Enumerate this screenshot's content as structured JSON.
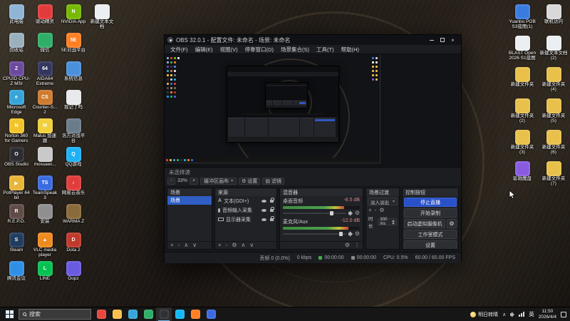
{
  "desktop": {
    "left_columns": [
      {
        "items": [
          {
            "label": "此电脑",
            "color": "#8fb4d4"
          },
          {
            "label": "回收站",
            "color": "#9bb0bd"
          },
          {
            "label": "CPUID CPU-Z MSI",
            "color": "#6b4a9e",
            "glyph": "Z"
          },
          {
            "label": "Microsoft Edge",
            "color": "#35a5d9",
            "glyph": "e"
          },
          {
            "label": "Norton 360 for Gamers",
            "color": "#f2c42a",
            "glyph": "N"
          },
          {
            "label": "OBS Studio",
            "color": "#2b2b30",
            "glyph": "O"
          },
          {
            "label": "PotPlayer 64 bit",
            "color": "#e8b53a",
            "glyph": "▶"
          },
          {
            "label": "R.E.P.O.",
            "color": "#5f4a46",
            "glyph": "R"
          },
          {
            "label": "Steam",
            "color": "#223c5e",
            "glyph": "S"
          },
          {
            "label": "腾讯会议",
            "color": "#2f8fe5"
          }
        ]
      },
      {
        "items": [
          {
            "label": "驱动精灵",
            "color": "#e23b3b"
          },
          {
            "label": "微信",
            "color": "#2fae68"
          },
          {
            "label": "AIDA64 Extreme",
            "color": "#33355e",
            "glyph": "64"
          },
          {
            "label": "Counter-S... 2",
            "color": "#cf7a2e",
            "glyph": "CS"
          },
          {
            "label": "Malus 加速器",
            "color": "#f2d03a",
            "glyph": "M"
          },
          {
            "label": "mossawi...",
            "color": "#c9c9c9"
          },
          {
            "label": "TeamSpeak 3",
            "color": "#3a6be0",
            "glyph": "TS"
          },
          {
            "label": "安装",
            "color": "#8f8f8f"
          },
          {
            "label": "VLC media player",
            "color": "#ef8a1e",
            "glyph": "▲"
          },
          {
            "label": "LINE",
            "color": "#06c152",
            "glyph": "L"
          }
        ]
      },
      {
        "items": [
          {
            "label": "NVIDIA App",
            "color": "#76b900",
            "glyph": "N"
          },
          {
            "label": "5E对战平台",
            "color": "#ff7e22",
            "glyph": "5E"
          },
          {
            "label": "系统信息",
            "color": "#4a90d9"
          },
          {
            "label": "我记了吗",
            "color": "#e9e9ec"
          },
          {
            "label": "浩方对战平台",
            "color": "#6a7b8a"
          },
          {
            "label": "QQ游戏",
            "color": "#1cb2f5",
            "glyph": "Q"
          },
          {
            "label": "网易云音乐",
            "color": "#e03c3c",
            "glyph": "♪"
          },
          {
            "label": "WARMA Z",
            "color": "#8a6a3a"
          },
          {
            "label": "Dota 2",
            "color": "#c0392b",
            "glyph": "D"
          },
          {
            "label": "Oopz",
            "color": "#6a5ae0"
          }
        ]
      },
      {
        "items": [
          {
            "label": "新建文本文档",
            "color": "#eceff1"
          }
        ]
      }
    ],
    "right_columns": [
      {
        "items": [
          {
            "label": "Yuanbo POB S3蓝图(1)",
            "color": "#3a7be0"
          },
          {
            "label": "BLAST Open 2026 S1蓝图",
            "color": "#eceff1"
          },
          {
            "label": "新建文件夹",
            "color": "#e8c04a"
          },
          {
            "label": "新建文件夹 (2)",
            "color": "#e8c04a"
          },
          {
            "label": "新建文件夹 (3)",
            "color": "#e8c04a"
          },
          {
            "label": "影驰魔盘",
            "color": "#8a5ae0"
          }
        ]
      },
      {
        "items": [
          {
            "label": "联机访问",
            "color": "#d8d8d8"
          },
          {
            "label": "新建文本文档 (2)",
            "color": "#eceff1"
          },
          {
            "label": "新建文件夹 (4)",
            "color": "#e8c04a"
          },
          {
            "label": "新建文件夹 (5)",
            "color": "#e8c04a"
          },
          {
            "label": "新建文件夹 (6)",
            "color": "#e8c04a"
          },
          {
            "label": "新建文件夹 (7)",
            "color": "#e8c04a"
          }
        ]
      }
    ]
  },
  "obs": {
    "title": "OBS 32.0.1 - 配置文件: 未命名 - 场景: 未命名",
    "menus": [
      "文件(F)",
      "编辑(E)",
      "视图(V)",
      "停靠窗口(D)",
      "场景集合(S)",
      "工具(T)",
      "帮助(H)"
    ],
    "context_bar": {
      "status": "未选择源"
    },
    "preview_toolbar": {
      "zoom_out": "-",
      "zoom": "33%",
      "zoom_in": "+",
      "canvas": "缓冲区画布",
      "settings": "设置",
      "filters": "滤镜"
    },
    "scenes": {
      "title": "场景",
      "items": [
        {
          "label": "场景",
          "selected": true
        }
      ],
      "toolbar": [
        "add",
        "remove",
        "up",
        "down"
      ]
    },
    "sources": {
      "title": "来源",
      "items": [
        {
          "label": "文本(GDI+)",
          "icon": "text-icon"
        },
        {
          "label": "音频输入采集",
          "icon": "mic-icon"
        },
        {
          "label": "显示器采集",
          "icon": "display-icon"
        }
      ],
      "toolbar": [
        "add",
        "remove",
        "gear",
        "up",
        "down"
      ]
    },
    "mixer": {
      "title": "混音器",
      "channels": [
        {
          "label": "桌面音频",
          "value": "-8.5 dB",
          "value_color": "#d98a8a",
          "meter": 0.8,
          "slider": 0.78
        },
        {
          "label": "麦克风/Aux",
          "value": "-12.0 dB",
          "value_color": "#d98a8a",
          "meter": 0.85,
          "slider": 0.92
        }
      ],
      "toolbar": [
        "gear",
        "dots"
      ]
    },
    "transitions": {
      "title": "场景过渡",
      "selected": "淡入淡出",
      "toolbar": [
        "add",
        "remove",
        "gear"
      ],
      "duration_label": "时长",
      "duration": "300 ms"
    },
    "controls": {
      "title": "控制按钮",
      "buttons": [
        {
          "label": "停止直播",
          "accent": true
        },
        {
          "label": "开始录制"
        },
        {
          "label": "启动虚拟摄像机",
          "gear": true
        },
        {
          "label": "工作室模式"
        },
        {
          "label": "设置"
        }
      ]
    },
    "statusbar": {
      "items": [
        {
          "label": "丢帧 0 (0.0%)"
        },
        {
          "label": "0 kbps"
        },
        {
          "label": "00:00:00",
          "dot": "#3fae4a"
        },
        {
          "label": "00:00:00",
          "dot": "#8a8b8d"
        },
        {
          "label": "CPU: 0.5%"
        },
        {
          "label": "60.00 / 60.00 FPS"
        }
      ]
    }
  },
  "taskbar": {
    "search_placeholder": "搜索",
    "apps": [
      {
        "name": "Chrome",
        "color": "#e8453c"
      },
      {
        "name": "文件资源管理器",
        "color": "#f8c04a"
      },
      {
        "name": "Microsoft Edge",
        "color": "#36a3d9"
      },
      {
        "name": "微信",
        "color": "#2fae68"
      },
      {
        "name": "OBS Studio",
        "color": "#2e3036",
        "active": true
      },
      {
        "name": "QQ",
        "color": "#12b7f5"
      },
      {
        "name": "5E对战平台",
        "color": "#ff7e22"
      },
      {
        "name": "Medal",
        "color": "#3a6be0"
      }
    ],
    "weather": "明日转晴",
    "ime": "英",
    "time": "11:50",
    "date": "2026/4/4"
  },
  "colors": {
    "accent_blue": "#2a52c8",
    "selection_blue": "#2f5fc4"
  }
}
